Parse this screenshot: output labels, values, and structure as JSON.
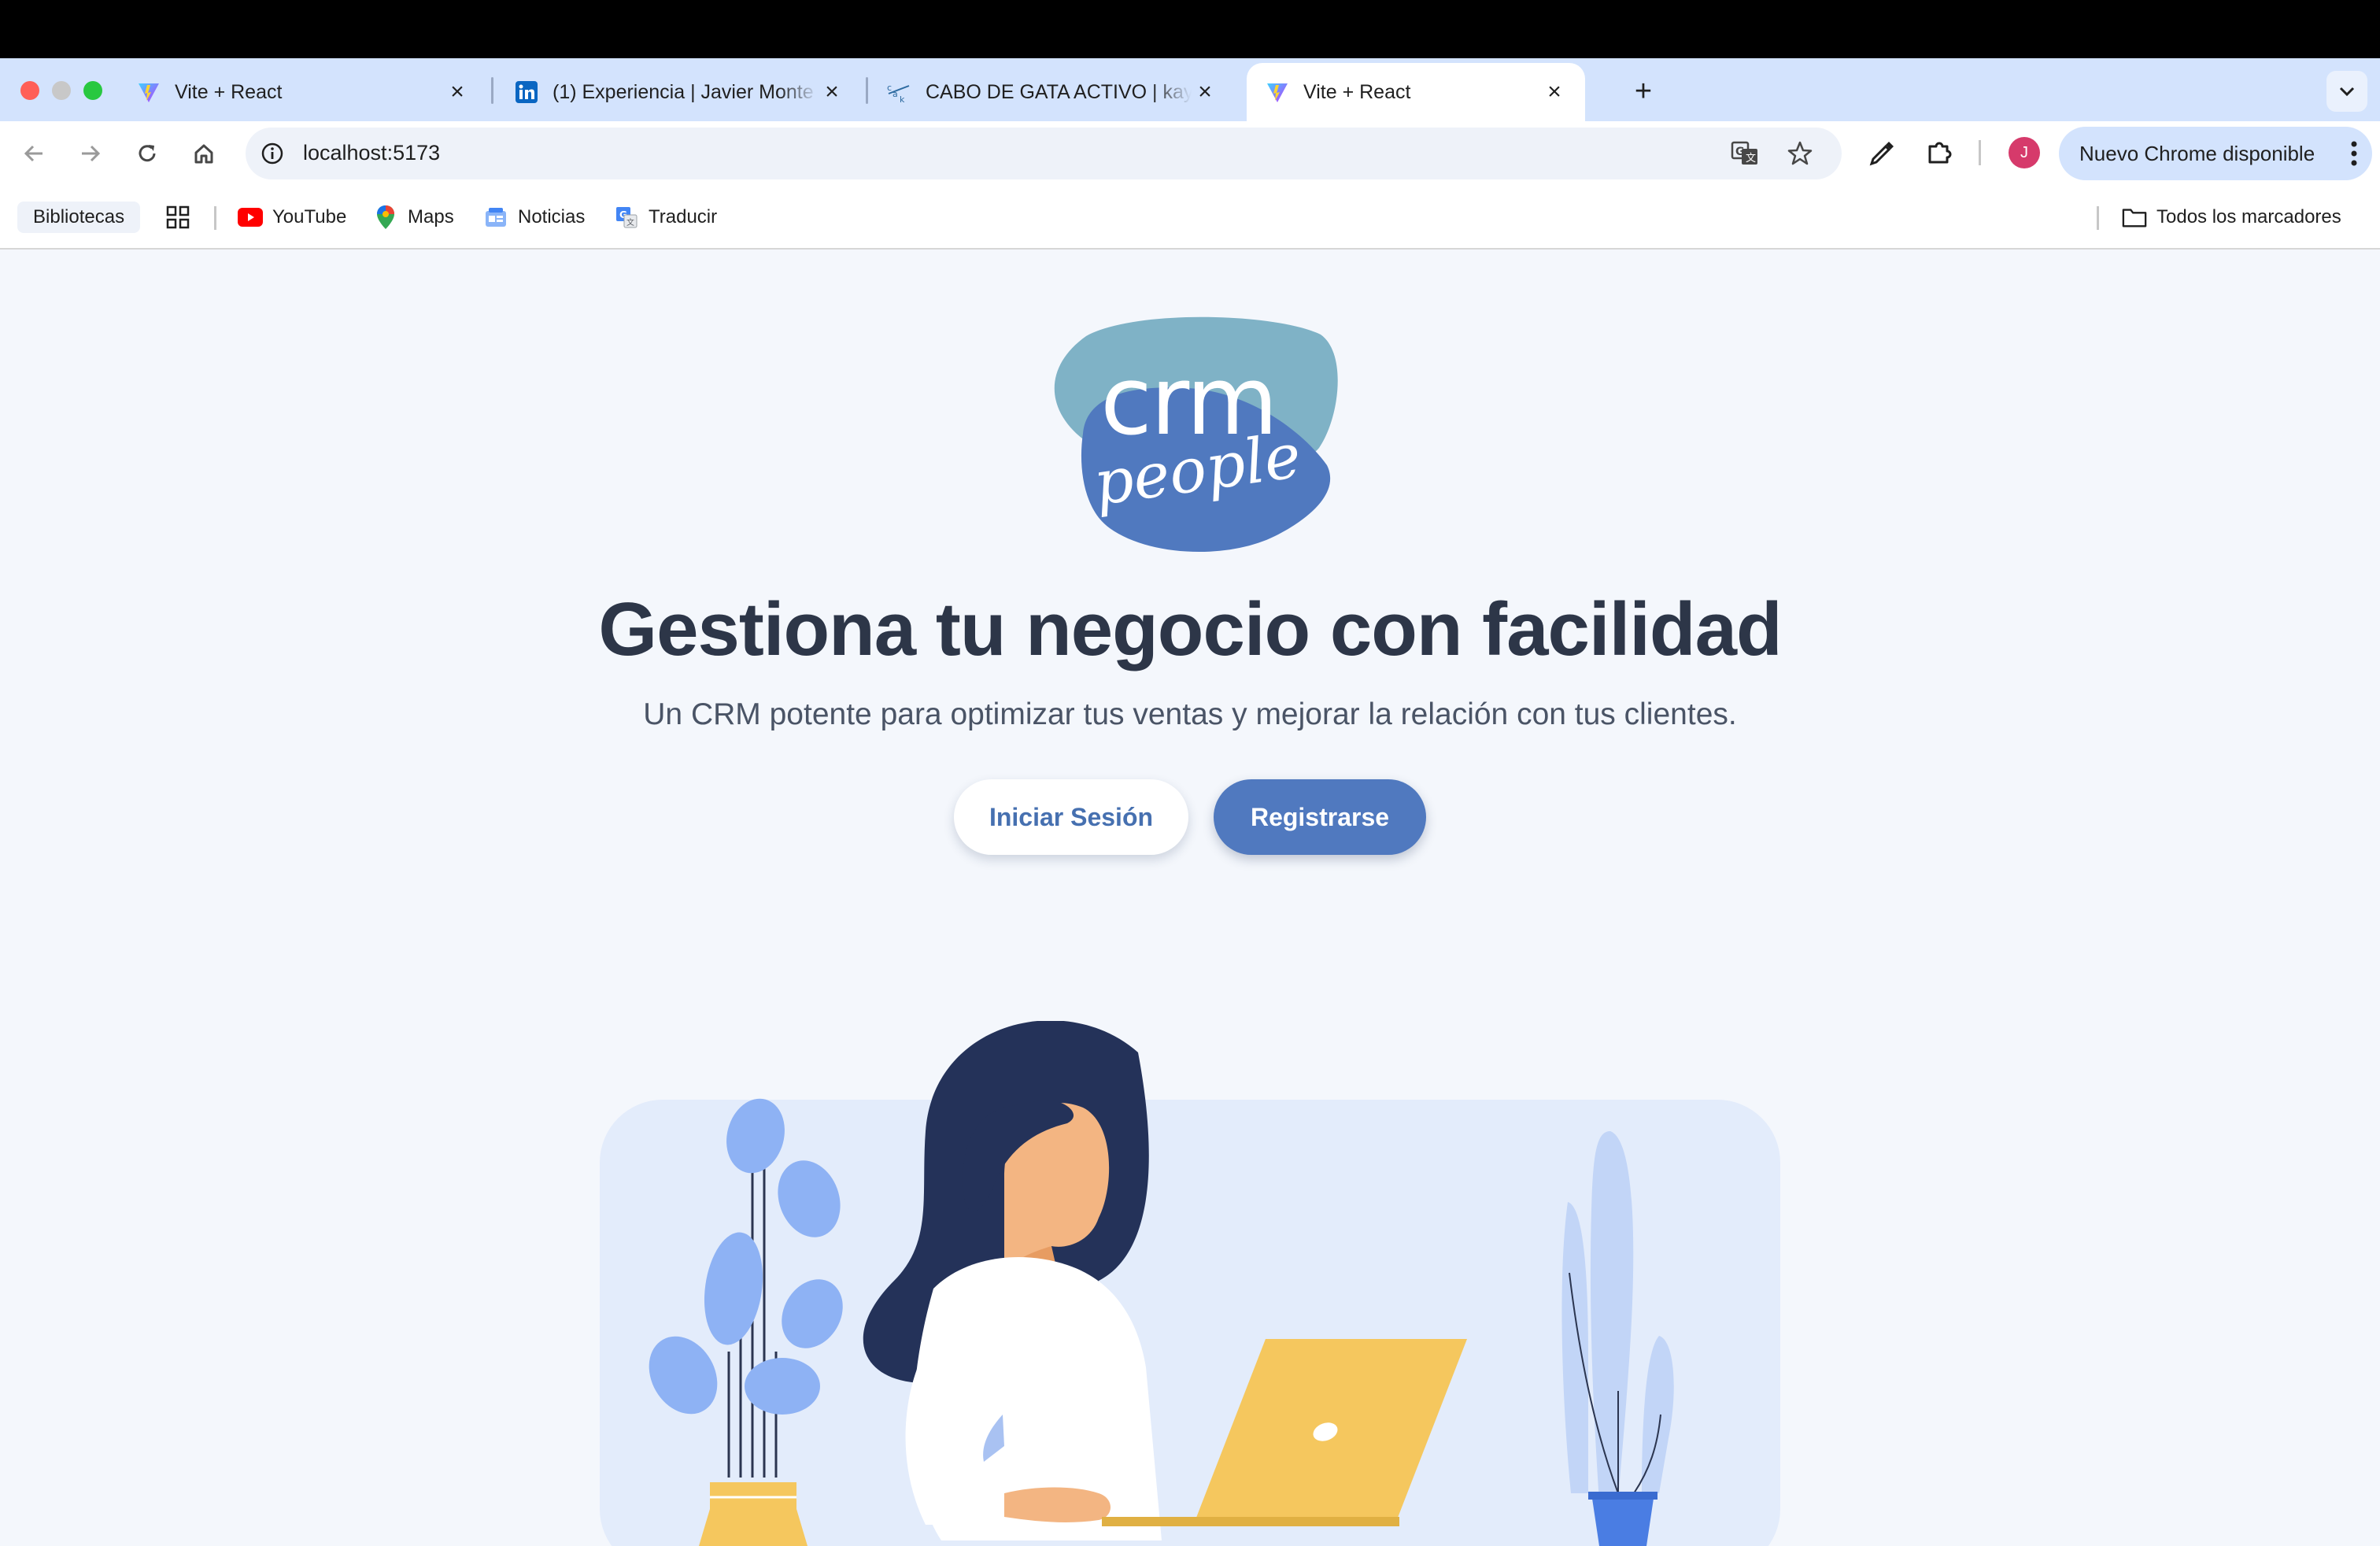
{
  "browser": {
    "tabs": [
      {
        "title": "Vite + React",
        "icon": "vite-icon",
        "active": false
      },
      {
        "title": "(1) Experiencia | Javier Monte",
        "icon": "linkedin-icon",
        "active": false
      },
      {
        "title": "CABO DE GATA ACTIVO | kaya",
        "icon": "kayak-icon",
        "active": false
      },
      {
        "title": "Vite + React",
        "icon": "vite-icon",
        "active": true
      }
    ],
    "new_tab_glyph": "+",
    "address": "localhost:5173",
    "update_button": "Nuevo Chrome disponible",
    "avatar_initial": "J",
    "bookmarks": {
      "bibliotecas": "Bibliotecas",
      "items": [
        {
          "label": "YouTube",
          "icon": "youtube-icon"
        },
        {
          "label": "Maps",
          "icon": "maps-icon"
        },
        {
          "label": "Noticias",
          "icon": "news-icon"
        },
        {
          "label": "Traducir",
          "icon": "translate-icon"
        }
      ],
      "all_bookmarks": "Todos los marcadores"
    }
  },
  "page": {
    "logo": {
      "word1": "crm",
      "word2": "people"
    },
    "headline": "Gestiona tu negocio con facilidad",
    "subline": "Un CRM potente para optimizar tus ventas y mejorar la relación con tus clientes.",
    "login_button": "Iniciar Sesión",
    "register_button": "Registrarse"
  },
  "colors": {
    "accent": "#5079bf",
    "headline": "#2d3648",
    "page_background": "#f4f7fc",
    "logo_teal": "#7fb2c6",
    "logo_blue": "#5079bf",
    "laptop_yellow": "#f5c75e"
  }
}
